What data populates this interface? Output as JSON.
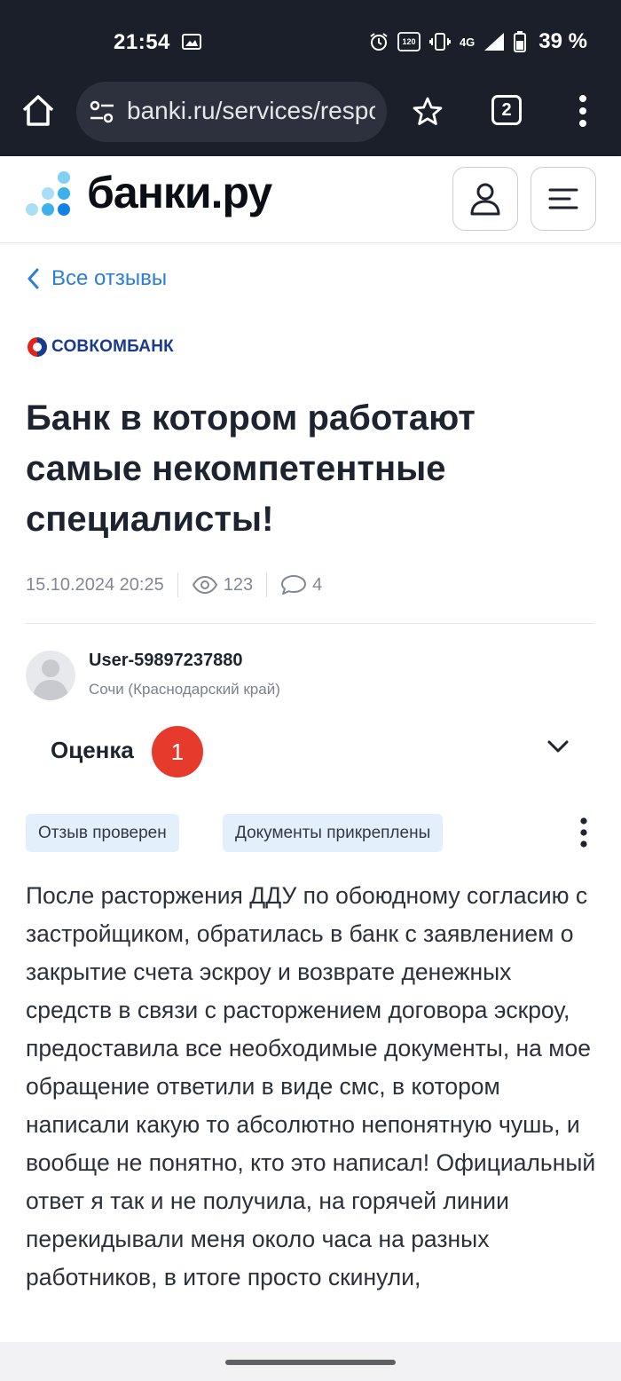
{
  "status_bar": {
    "time": "21:54",
    "network": "4G",
    "refresh_badge": "120",
    "battery": "39 %"
  },
  "browser": {
    "url": "banki.ru/services/responses",
    "tab_count": "2"
  },
  "site": {
    "logo_text": "банки.ру"
  },
  "nav": {
    "back_label": "Все отзывы"
  },
  "bank": {
    "name": "СОВКОМБАНК"
  },
  "review": {
    "title": "Банк в котором работают самые некомпетентные специалисты!",
    "date": "15.10.2024 20:25",
    "views": "123",
    "comments": "4",
    "author": "User-59897237880",
    "location": "Сочи (Краснодарский край)",
    "rating_label": "Оценка",
    "rating_value": "1",
    "tags": [
      "Отзыв проверен",
      "Документы прикреплены"
    ],
    "text": "После расторжения ДДУ по обоюдному согласию с застройщиком, обратилась в банк с заявлением о закрытие счета эскроу и возврате денежных средств в связи с расторжением договора эскроу, предоставила все необходимые документы, на мое обращение ответили в виде смс, в котором написали какую то абсолютно непонятную чушь, и вообще не понятно, кто это написал! Официальный ответ я так и не получила, на горячей линии перекидывали меня около часа на разных работников, в итоге просто скинули,"
  },
  "colors": {
    "accent": "#2a7fdb",
    "rating_badge": "#e53a2c",
    "tag_bg": "#e3effb",
    "browser_bg": "#1b1f2a"
  }
}
